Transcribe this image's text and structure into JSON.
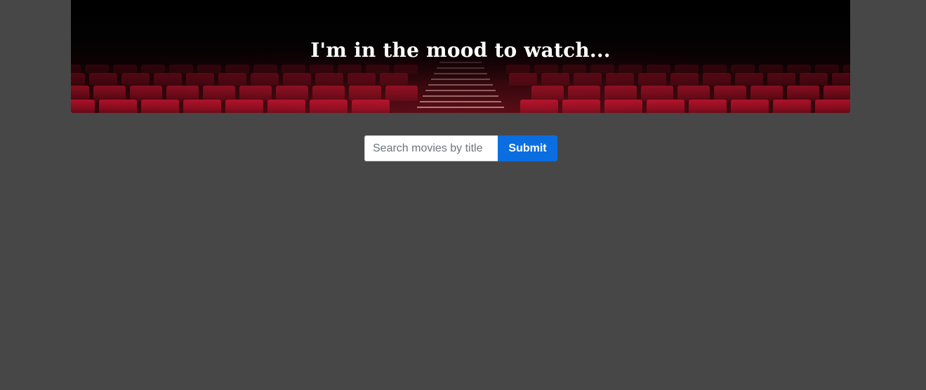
{
  "hero": {
    "title": "I'm in the mood to watch..."
  },
  "search": {
    "placeholder": "Search movies by title",
    "value": "",
    "submit_label": "Submit"
  },
  "colors": {
    "page_background": "#474747",
    "submit_button": "#0a6ee0",
    "seat_red": "#8e0b1e"
  }
}
